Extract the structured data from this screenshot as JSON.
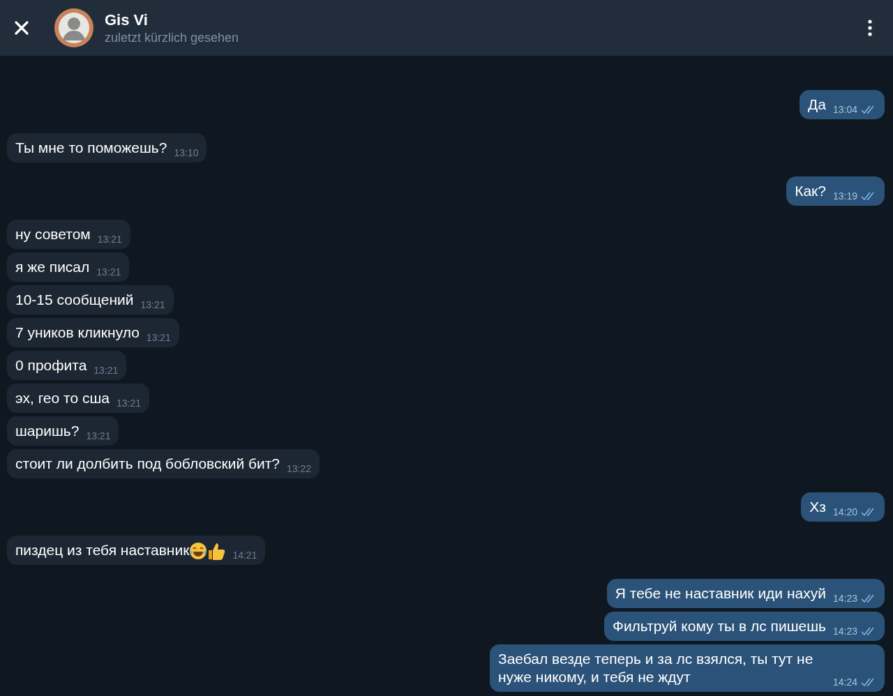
{
  "header": {
    "title": "Gis Vi",
    "status": "zuletzt kürzlich gesehen"
  },
  "messages": [
    {
      "outgoing": true,
      "text": "Да",
      "time": "13:04",
      "read": true
    },
    {
      "outgoing": false,
      "text": "Ты мне то поможешь?",
      "time": "13:10"
    },
    {
      "outgoing": true,
      "text": "Как?",
      "time": "13:19",
      "read": true
    },
    {
      "outgoing": false,
      "text": "ну советом",
      "time": "13:21"
    },
    {
      "outgoing": false,
      "text": "я же писал",
      "time": "13:21"
    },
    {
      "outgoing": false,
      "text": "10-15 сообщений",
      "time": "13:21"
    },
    {
      "outgoing": false,
      "text": "7 уников кликнуло",
      "time": "13:21"
    },
    {
      "outgoing": false,
      "text": "0 профита",
      "time": "13:21"
    },
    {
      "outgoing": false,
      "text": "эх, гео то сша",
      "time": "13:21"
    },
    {
      "outgoing": false,
      "text": "шаришь?",
      "time": "13:21"
    },
    {
      "outgoing": false,
      "text": "стоит ли долбить под бобловский бит?",
      "time": "13:22"
    },
    {
      "outgoing": true,
      "text": "Хз",
      "time": "14:20",
      "read": true
    },
    {
      "outgoing": false,
      "text": "пиздец из тебя наставник",
      "time": "14:21",
      "emojis": [
        {
          "kind": "tears-of-joy"
        },
        {
          "kind": "thumbs-up"
        }
      ]
    },
    {
      "outgoing": true,
      "text": "Я тебе не наставник иди нахуй",
      "time": "14:23",
      "read": true
    },
    {
      "outgoing": true,
      "text": "Фильтруй кому ты в лс пишешь",
      "time": "14:23",
      "read": true
    },
    {
      "outgoing": true,
      "text": "Заебал везде теперь и за лс взялся, ты тут не нуже никому, и тебя не ждут",
      "time": "14:24",
      "read": true
    }
  ]
}
